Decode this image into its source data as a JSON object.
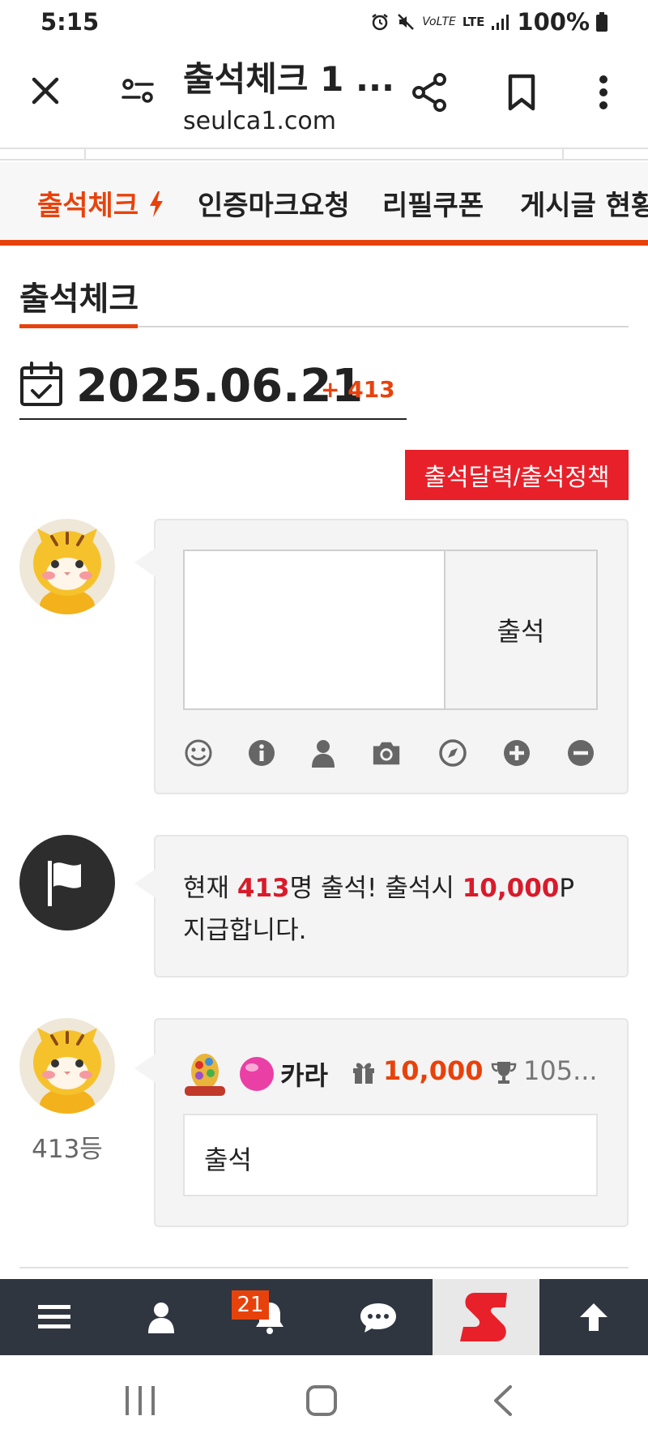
{
  "status_bar": {
    "time": "5:15",
    "network": "LTE",
    "battery": "100%"
  },
  "browser": {
    "title": "출석체크 1 ...",
    "url": "seulca1.com"
  },
  "menu": {
    "items": [
      {
        "label": "출석체크",
        "active": true
      },
      {
        "label": "인증마크요청",
        "active": false
      },
      {
        "label": "리필쿠폰",
        "active": false
      },
      {
        "label": "게시글 현황",
        "active": false
      }
    ]
  },
  "section": {
    "title": "출석체크"
  },
  "date": {
    "value": "2025.06.21",
    "count": "+ 413"
  },
  "policy_button": "출석달력/출석정책",
  "write": {
    "submit_label": "출석",
    "tools": [
      "smile-icon",
      "info-icon",
      "user-icon",
      "camera-icon",
      "compass-icon",
      "plus-circle-icon",
      "minus-circle-icon"
    ]
  },
  "notice": {
    "prefix": "현재 ",
    "count": "413",
    "middle": "명 출석! 출석시 ",
    "points": "10,000",
    "suffix": "P 지급합니다."
  },
  "entry": {
    "rank": "413등",
    "nickname": "카라",
    "points": "10,000",
    "trophy": "105...",
    "comment": "출석"
  },
  "app_bar": {
    "notification_count": "21"
  },
  "colors": {
    "accent": "#e8420c",
    "highlight": "#d81b2b",
    "button_red": "#e8202a",
    "app_bar": "#2f3640"
  }
}
